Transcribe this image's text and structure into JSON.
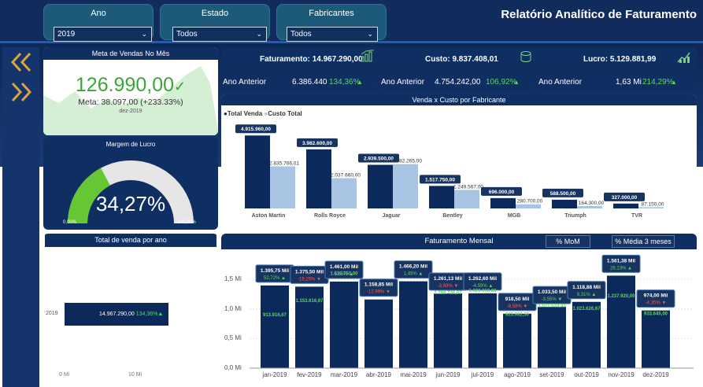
{
  "filters": [
    {
      "label": "Ano",
      "value": "2019"
    },
    {
      "label": "Estado",
      "value": "Todos"
    },
    {
      "label": "Fabricantes",
      "value": "Todos"
    }
  ],
  "report_title": "Relatório Analítico de Faturamento",
  "nav": {
    "back_icon": "double-chevron-left-icon",
    "forward_icon": "double-chevron-right-icon"
  },
  "meta": {
    "title": "Meta de Vendas No Mês",
    "value": "126.990,00",
    "check": "✓",
    "meta_line": "Meta: 38.097,00 (+233.33%)",
    "period": "dez-2019"
  },
  "margem": {
    "title": "Margem de Lucro",
    "value": "34,27%",
    "min": "0,00%",
    "max": "100,00%",
    "fraction": 0.3427
  },
  "kpis": [
    {
      "label": "Faturamento:",
      "value": "14.967.290,00",
      "icon": "bar-chart-icon",
      "prev_label": "Ano Anterior",
      "prev_value": "6.386.440",
      "change": "134,36%"
    },
    {
      "label": "Custo:",
      "value": "9.837.408,01",
      "icon": "coins-icon",
      "prev_label": "Ano Anterior",
      "prev_value": "4.754.242,00",
      "change": "106,92%"
    },
    {
      "label": "Lucro:",
      "value": "5.129.881,99",
      "icon": "growth-icon",
      "prev_label": "Ano Anterior",
      "prev_value": "1,63 Mi",
      "change": "214,29%"
    }
  ],
  "up_arrow": "▲",
  "down_arrow": "▼",
  "fab_chart": {
    "title": "Venda x Custo por Fabricante",
    "legend": [
      "Total Venda",
      "Custo Total"
    ],
    "colors": [
      "#0b2a5b",
      "#a9c4e2"
    ]
  },
  "ano_chart": {
    "title": "Total de venda por ano",
    "label_value": "14.967.290,00",
    "label_change": "134,36%",
    "x_ticks": [
      "0 Mi",
      "10 Mi"
    ]
  },
  "mensal": {
    "title": "Faturamento Mensal",
    "btn_mom": "% MoM",
    "btn_media": "% Média 3 meses",
    "y_ticks": [
      "1,5 Mi",
      "1,0 Mi",
      "0,5 Mi",
      "0,0 Mi"
    ],
    "ytick_values": [
      1.5,
      1.0,
      0.5,
      0.0
    ]
  },
  "chart_data": [
    {
      "type": "bar",
      "title": "Venda x Custo por Fabricante",
      "categories": [
        "Aston Martin",
        "Rolls Royce",
        "Jaguar",
        "Bentley",
        "MGB",
        "Triumph",
        "TVR"
      ],
      "series": [
        {
          "name": "Total Venda",
          "values": [
            4915960.0,
            3982600.0,
            2939500.0,
            1517750.0,
            696000.0,
            588500.0,
            327000.0
          ],
          "labels": [
            "4.915.960,00",
            "3.982.600,00",
            "2.939.500,00",
            "1.517.750,00",
            "696.000,00",
            "588.500,00",
            "327.000,00"
          ]
        },
        {
          "name": "Custo Total",
          "values": [
            2835766.01,
            2037660.0,
            2982265.0,
            1249567.0,
            280700.0,
            164300.0,
            87150.0
          ],
          "labels": [
            "2.835.766,01",
            "2.037.660,00",
            "2.982.265,00",
            "1.249.567,00",
            "280.700,00",
            "164.300,00",
            "87.150,00"
          ]
        }
      ],
      "ylim": [
        0,
        5300000
      ]
    },
    {
      "type": "bar",
      "title": "Total de venda por ano",
      "categories": [
        "2019"
      ],
      "values": [
        14967290.0
      ],
      "xlim": [
        0,
        20000000
      ]
    },
    {
      "type": "bar",
      "title": "Faturamento Mensal",
      "categories": [
        "jan-2019",
        "fev-2019",
        "mar-2019",
        "abr-2019",
        "mai-2019",
        "jun-2019",
        "jul-2019",
        "ago-2019",
        "set-2019",
        "out-2019",
        "nov-2019",
        "dez-2019"
      ],
      "values": [
        1395750,
        1375500,
        1461000,
        1158850,
        1466200,
        1261130,
        1262600,
        918500,
        1033500,
        1118880,
        1561380,
        974000
      ],
      "value_labels": [
        "1.395,75 Mil",
        "1.375,50 Mil",
        "1.461,00 Mil",
        "1.158,85 Mil",
        "1.466,20 Mil",
        "1.261,13 Mil",
        "1.262,60 Mil",
        "918,50 Mil",
        "1.033,50 Mil",
        "1.118,88 Mil",
        "1.561,38 Mil",
        "974,00 Mil"
      ],
      "mom": [
        "52,72%",
        "-19,25%",
        "5,56%",
        "-12,99%",
        "1,45%",
        "-3,69%",
        "-4,59%",
        "-8,59%",
        "-3,55%",
        "9,31%",
        "26,13%",
        "-4,35%"
      ],
      "mom_dir": [
        "up",
        "down",
        "up",
        "down",
        "up",
        "down",
        "up",
        "down",
        "down",
        "up",
        "up",
        "down"
      ],
      "mom_color": [
        "green",
        "red",
        "green",
        "red",
        "green",
        "red",
        "green",
        "red",
        "green",
        "green",
        "green",
        "red"
      ],
      "media3": [
        913916.67,
        1153616.67,
        1610750.0,
        null,
        null,
        1288726.67,
        1323310.0,
        923982.5,
        1071533.33,
        1023626.67,
        1237920.0,
        933640.0
      ],
      "media3_labels": [
        "913.916,67",
        "1.153.616,67",
        "1.610.750,00",
        "",
        "",
        "1.288.726,67",
        "1.323.310,00",
        "923.982,50",
        "1.071.533,33",
        "1.023.626,67",
        "1.237.920,00",
        "933.640,00"
      ],
      "ylim": [
        0,
        1700000
      ],
      "yticks": [
        0,
        500000,
        1000000,
        1500000
      ]
    }
  ]
}
